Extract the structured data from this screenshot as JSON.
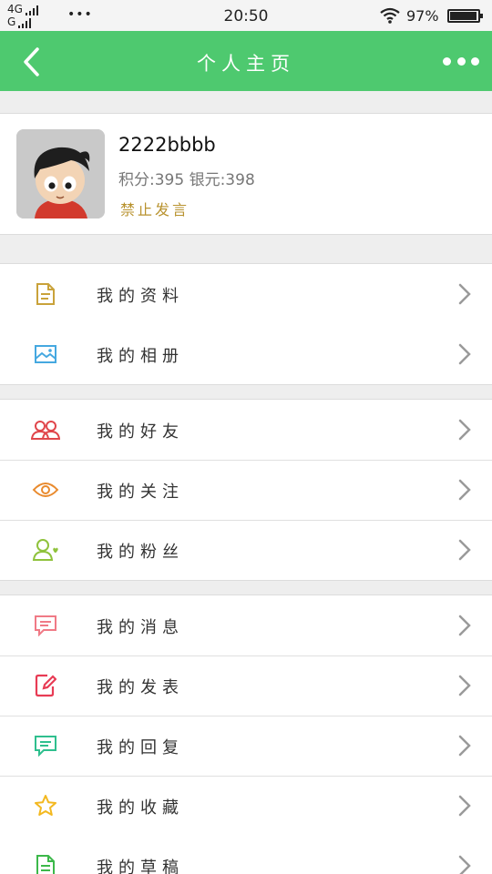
{
  "status_bar": {
    "net_top": "4G",
    "net_bottom": "G",
    "dots": "•••",
    "time": "20:50",
    "battery_pct": "97%",
    "battery_level": 0.97
  },
  "header": {
    "title": "个人主页",
    "back_icon": "chevron-left-icon",
    "more_icon": "more-dots-icon"
  },
  "profile": {
    "username": "2222bbbb",
    "score_text": "积分:395 银元:398",
    "status_text": "禁止发言"
  },
  "menu": {
    "group1": [
      {
        "label": "我的资料",
        "icon": "document-icon",
        "color": "#c9a23a"
      },
      {
        "label": "我的相册",
        "icon": "image-icon",
        "color": "#45a8e0"
      }
    ],
    "group2": [
      {
        "label": "我的好友",
        "icon": "friends-icon",
        "color": "#e0464b"
      },
      {
        "label": "我的关注",
        "icon": "eye-icon",
        "color": "#e98a2d"
      },
      {
        "label": "我的粉丝",
        "icon": "fan-user-icon",
        "color": "#8fc23c"
      }
    ],
    "group3": [
      {
        "label": "我的消息",
        "icon": "message-icon",
        "color": "#f07a86"
      },
      {
        "label": "我的发表",
        "icon": "edit-icon",
        "color": "#e83c55"
      },
      {
        "label": "我的回复",
        "icon": "reply-icon",
        "color": "#2fbf8e"
      },
      {
        "label": "我的收藏",
        "icon": "star-icon",
        "color": "#f3b81f"
      },
      {
        "label": "我的草稿",
        "icon": "draft-icon",
        "color": "#3cb84a"
      }
    ]
  },
  "colors": {
    "primary": "#4ec96f",
    "background": "#eeeeee",
    "status_text": "#b8922e"
  }
}
